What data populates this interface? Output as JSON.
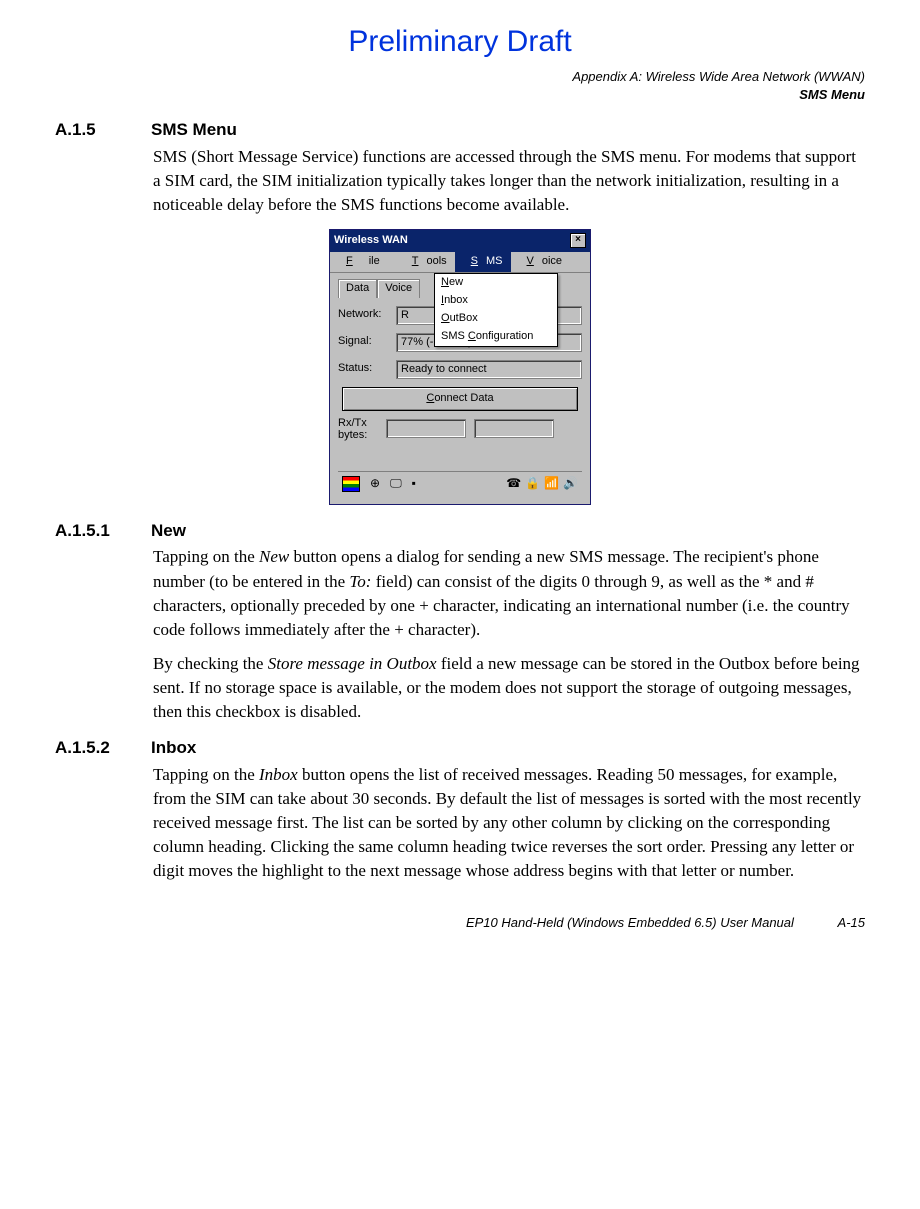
{
  "prelim": "Preliminary Draft",
  "header": {
    "line1": "Appendix A: Wireless Wide Area Network (WWAN)",
    "line2": "SMS Menu"
  },
  "sections": {
    "s1": {
      "num": "A.1.5",
      "title": "SMS Menu"
    },
    "s2": {
      "num": "A.1.5.1",
      "title": "New"
    },
    "s3": {
      "num": "A.1.5.2",
      "title": "Inbox"
    }
  },
  "para": {
    "p1": "SMS (Short Message Service) functions are accessed through the SMS menu. For modems that support a SIM card, the SIM initialization typically takes longer than the network initialization, resulting in a noticeable delay before the SMS functions become available.",
    "p2a": "Tapping on the ",
    "p2b": "New",
    "p2c": " button opens a dialog for sending a new SMS message. The recipient's phone number (to be entered in the ",
    "p2d": "To:",
    "p2e": " field) can consist of the digits 0 through 9, as well as the * and # characters, optionally preceded by one + character, indicating an international number (i.e. the country code follows immediately after the + character).",
    "p3a": "By checking the ",
    "p3b": "Store message in Outbox",
    "p3c": " field a new message can be stored in the Outbox before being sent. If no storage space is available, or the modem does not support the storage of outgoing messages, then this checkbox is disabled.",
    "p4a": "Tapping on the ",
    "p4b": "Inbox",
    "p4c": " button opens the list of received messages. Reading 50 messages, for example, from the SIM can take about 30 seconds. By default the list of messages is sorted with the most recently received message first. The list can be sorted by any other column by clicking on the corresponding column heading. Clicking the same column heading twice reverses the sort order. Pressing any letter or digit moves the highlight to the next message whose address begins with that letter or number."
  },
  "fig": {
    "title": "Wireless WAN",
    "menu": {
      "file": "File",
      "tools": "Tools",
      "sms": "SMS",
      "voice": "Voice"
    },
    "tabs": {
      "data": "Data",
      "voice": "Voice"
    },
    "dropdown": {
      "new": "New",
      "inbox": "Inbox",
      "outbox": "OutBox",
      "cfg": "SMS Configuration"
    },
    "labels": {
      "network": "Network:",
      "signal": "Signal:",
      "status": "Status:",
      "rxtx": "Rx/Tx bytes:"
    },
    "vals": {
      "network": "R",
      "signal": "77% (-65dBm)",
      "status": "Ready to connect"
    },
    "button": "Connect Data"
  },
  "footer": {
    "text": "EP10 Hand-Held (Windows Embedded 6.5) User Manual",
    "page": "A-15"
  }
}
